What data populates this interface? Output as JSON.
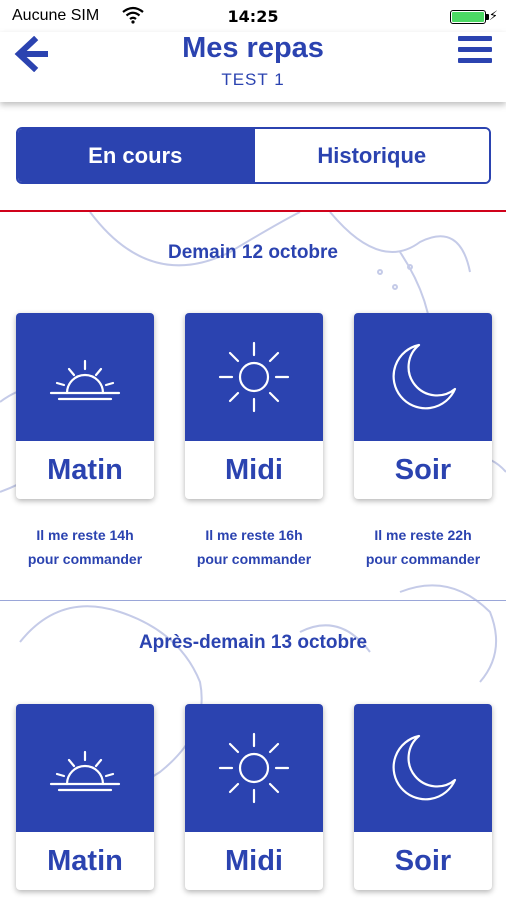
{
  "status_bar": {
    "carrier": "Aucune SIM",
    "time": "14:25",
    "battery_level": 1.0
  },
  "header": {
    "title": "Mes repas",
    "subtitle": "TEST 1",
    "back_icon": "arrow-left-icon",
    "menu_icon": "hamburger-menu-icon"
  },
  "tabs": [
    {
      "label": "En cours",
      "active": true
    },
    {
      "label": "Historique",
      "active": false
    }
  ],
  "days": [
    {
      "title": "Demain 12 octobre",
      "meals": [
        {
          "label": "Matin",
          "icon": "sunrise-icon",
          "remaining_line1": "Il me reste 14h",
          "remaining_line2": "pour commander"
        },
        {
          "label": "Midi",
          "icon": "sun-icon",
          "remaining_line1": "Il me reste 16h",
          "remaining_line2": "pour commander"
        },
        {
          "label": "Soir",
          "icon": "moon-icon",
          "remaining_line1": "Il me reste 22h",
          "remaining_line2": "pour commander"
        }
      ]
    },
    {
      "title": "Après-demain 13 octobre",
      "meals": [
        {
          "label": "Matin",
          "icon": "sunrise-icon"
        },
        {
          "label": "Midi",
          "icon": "sun-icon"
        },
        {
          "label": "Soir",
          "icon": "moon-icon"
        }
      ]
    }
  ],
  "colors": {
    "primary": "#2b43b0",
    "accent_line": "#d0021b",
    "battery": "#4cd964"
  }
}
